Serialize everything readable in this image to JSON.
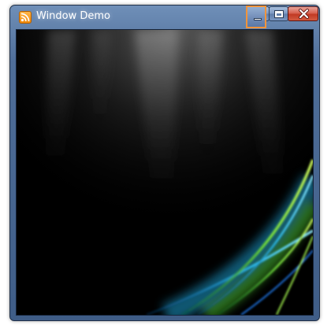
{
  "window": {
    "title": "Window Demo",
    "icon": "rss-feed-icon"
  },
  "caption_buttons": {
    "minimize": "minimize-icon",
    "maximize": "maximize-icon",
    "close": "close-icon"
  },
  "colors": {
    "frame": "#4f6e99",
    "focus_highlight": "#f1943b",
    "close_button": "#c13a24",
    "wallpaper_background": "#000000",
    "aurora_green": "#7fe03a",
    "aurora_cyan": "#2fc6e6"
  }
}
